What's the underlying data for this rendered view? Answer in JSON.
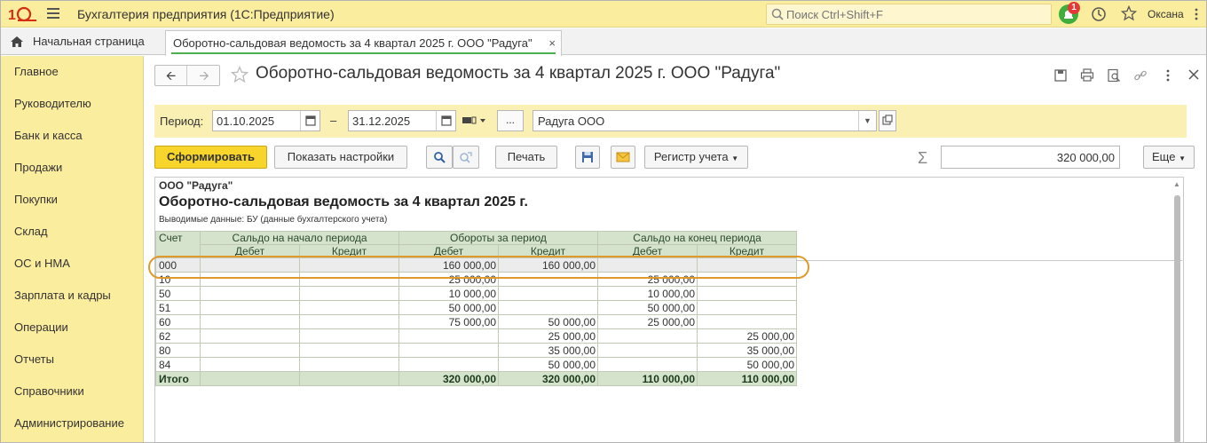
{
  "app": {
    "title": "Бухгалтерия предприятия  (1С:Предприятие)",
    "search_placeholder": "Поиск Ctrl+Shift+F",
    "notifications_count": "1",
    "user": "Оксана"
  },
  "tabs": {
    "home": "Начальная страница",
    "document": "Оборотно-сальдовая ведомость за 4 квартал 2025 г. ООО \"Радуга\"",
    "close": "×"
  },
  "sidebar": {
    "items": [
      "Главное",
      "Руководителю",
      "Банк и касса",
      "Продажи",
      "Покупки",
      "Склад",
      "ОС и НМА",
      "Зарплата и кадры",
      "Операции",
      "Отчеты",
      "Справочники",
      "Администрирование"
    ]
  },
  "form": {
    "title": "Оборотно-сальдовая ведомость за 4 квартал 2025 г. ООО \"Радуга\"",
    "period_label": "Период:",
    "date_from": "01.10.2025",
    "dash": "–",
    "date_to": "31.12.2025",
    "dots": "...",
    "organization": "Радуга ООО"
  },
  "toolbar": {
    "generate": "Сформировать",
    "show_settings": "Показать настройки",
    "print": "Печать",
    "register": "Регистр учета",
    "sum": "320 000,00",
    "more": "Еще"
  },
  "report": {
    "org": "ООО \"Радуга\"",
    "title": "Оборотно-сальдовая ведомость за 4 квартал 2025 г.",
    "note": "Выводимые данные: БУ (данные бухгалтерского учета)",
    "headers": {
      "account": "Счет",
      "opening": "Сальдо на начало периода",
      "turnover": "Обороты за период",
      "closing": "Сальдо на конец периода",
      "debit": "Дебет",
      "credit": "Кредит"
    },
    "rows": [
      {
        "acc": "000",
        "od": "",
        "oc": "",
        "td": "160 000,00",
        "tc": "160 000,00",
        "cd": "",
        "cc": ""
      },
      {
        "acc": "10",
        "od": "",
        "oc": "",
        "td": "25 000,00",
        "tc": "",
        "cd": "25 000,00",
        "cc": ""
      },
      {
        "acc": "50",
        "od": "",
        "oc": "",
        "td": "10 000,00",
        "tc": "",
        "cd": "10 000,00",
        "cc": ""
      },
      {
        "acc": "51",
        "od": "",
        "oc": "",
        "td": "50 000,00",
        "tc": "",
        "cd": "50 000,00",
        "cc": ""
      },
      {
        "acc": "60",
        "od": "",
        "oc": "",
        "td": "75 000,00",
        "tc": "50 000,00",
        "cd": "25 000,00",
        "cc": ""
      },
      {
        "acc": "62",
        "od": "",
        "oc": "",
        "td": "",
        "tc": "25 000,00",
        "cd": "",
        "cc": "25 000,00"
      },
      {
        "acc": "80",
        "od": "",
        "oc": "",
        "td": "",
        "tc": "35 000,00",
        "cd": "",
        "cc": "35 000,00"
      },
      {
        "acc": "84",
        "od": "",
        "oc": "",
        "td": "",
        "tc": "50 000,00",
        "cd": "",
        "cc": "50 000,00"
      }
    ],
    "total": {
      "acc": "Итого",
      "od": "",
      "oc": "",
      "td": "320 000,00",
      "tc": "320 000,00",
      "cd": "110 000,00",
      "cc": "110 000,00"
    }
  },
  "colors": {
    "accent_yellow": "#fbed9e",
    "primary_button": "#f7d52a",
    "table_header": "#d6e3cc",
    "highlight": "#e09a2c"
  }
}
